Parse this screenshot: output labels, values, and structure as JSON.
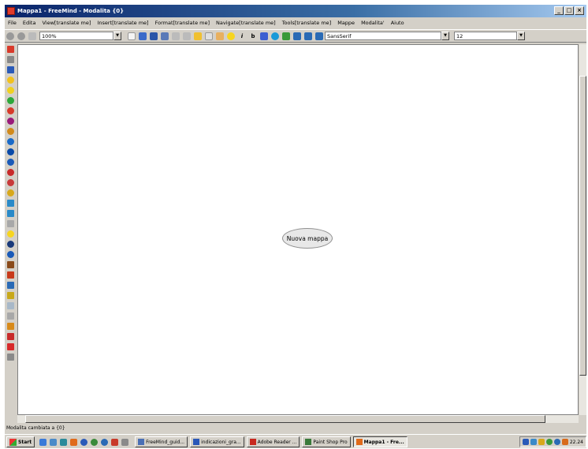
{
  "window": {
    "title": "Mappa1 - FreeMind - Modalita {0}"
  },
  "window_buttons": {
    "minimize": "_",
    "maximize": "□",
    "close": "×"
  },
  "menu": [
    "File",
    "Edita",
    "View[translate me]",
    "Insert[translate me]",
    "Format[translate me]",
    "Navigate[translate me]",
    "Tools[translate me]",
    "Mappe",
    "Modalita'",
    "Aiuto"
  ],
  "toolbar": {
    "zoom": "100%",
    "font": "SansSerif",
    "size": "12"
  },
  "canvas": {
    "root_node": "Nuova mappa"
  },
  "status": "Modalita cambiata a {0}",
  "taskbar": {
    "start": "Start",
    "tasks": [
      {
        "label": "FreeMind_guid...",
        "icon_color": "#4a6fb5"
      },
      {
        "label": "indicazioni_gra...",
        "icon_color": "#2a57b8"
      },
      {
        "label": "Adobe Reader ...",
        "icon_color": "#c8281e"
      },
      {
        "label": "Paint Shop Pro",
        "icon_color": "#3a7a3a"
      },
      {
        "label": "Mappa1 - Fre...",
        "icon_color": "#e06a1a",
        "active": true
      }
    ],
    "clock": "22.24"
  },
  "colors": {
    "titlebar": "#0a246a",
    "node_fill": "#e8e8e8",
    "chrome": "#d4d0c8"
  }
}
